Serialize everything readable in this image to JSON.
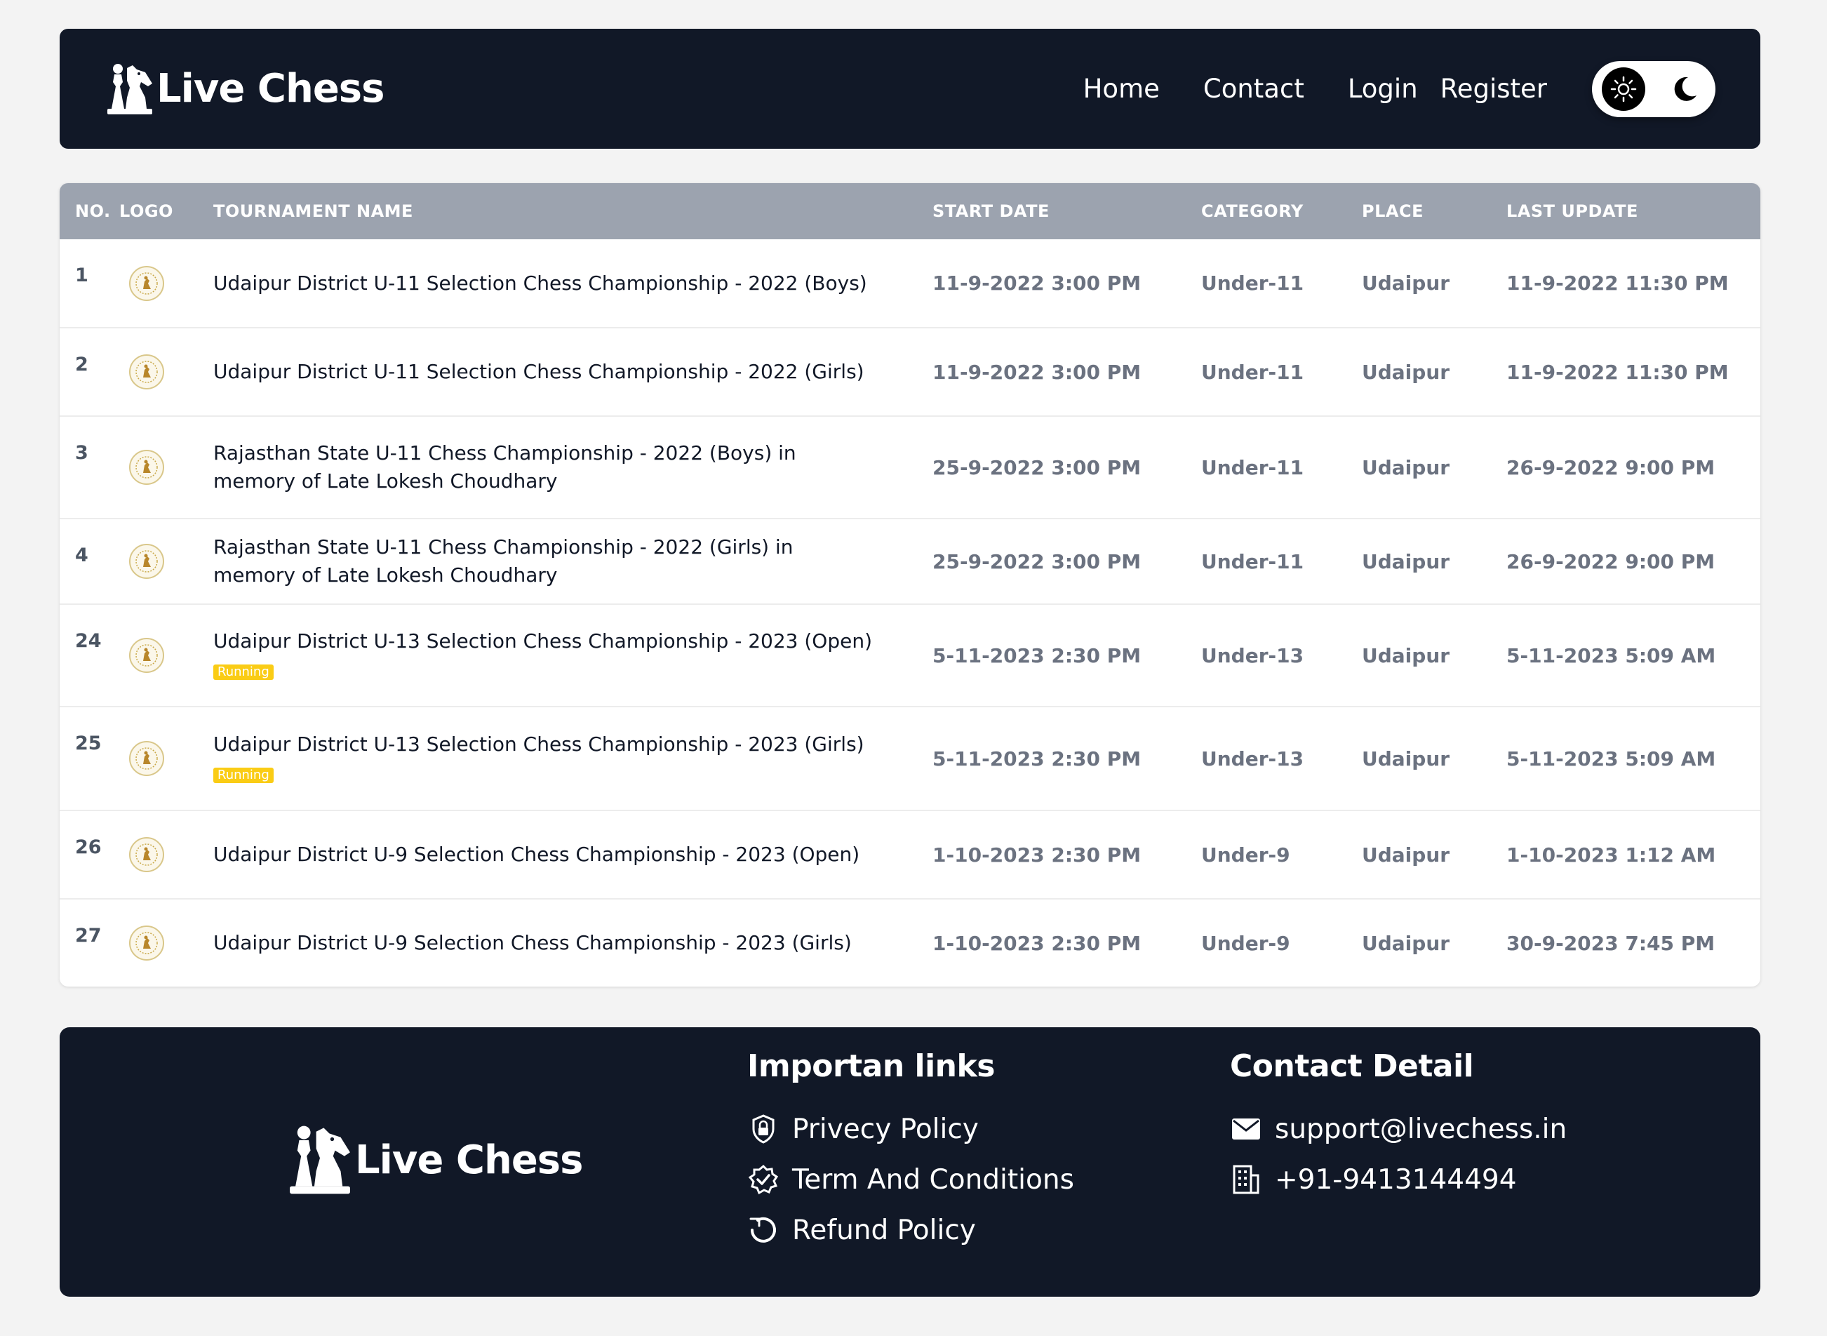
{
  "brand": {
    "name": "Live Chess"
  },
  "nav": {
    "home": "Home",
    "contact": "Contact",
    "login": "Login",
    "register": "Register"
  },
  "table": {
    "columns": {
      "no": "NO.",
      "logo": "LOGO",
      "name": "TOURNAMENT NAME",
      "start": "START DATE",
      "category": "CATEGORY",
      "place": "PLACE",
      "updated": "LAST UPDATE"
    },
    "rows": [
      {
        "no": "1",
        "name": "Udaipur District U-11 Selection Chess Championship - 2022 (Boys)",
        "badge": "",
        "start": "11-9-2022 3:00 PM",
        "category": "Under-11",
        "place": "Udaipur",
        "updated": "11-9-2022 11:30 PM"
      },
      {
        "no": "2",
        "name": "Udaipur District U-11 Selection Chess Championship - 2022 (Girls)",
        "badge": "",
        "start": "11-9-2022 3:00 PM",
        "category": "Under-11",
        "place": "Udaipur",
        "updated": "11-9-2022 11:30 PM"
      },
      {
        "no": "3",
        "name": "Rajasthan State U-11 Chess Championship - 2022 (Boys) in memory of Late Lokesh Choudhary",
        "badge": "",
        "start": "25-9-2022 3:00 PM",
        "category": "Under-11",
        "place": "Udaipur",
        "updated": "26-9-2022 9:00 PM"
      },
      {
        "no": "4",
        "name": "Rajasthan State U-11 Chess Championship - 2022 (Girls) in memory of Late Lokesh Choudhary",
        "badge": "",
        "start": "25-9-2022 3:00 PM",
        "category": "Under-11",
        "place": "Udaipur",
        "updated": "26-9-2022 9:00 PM"
      },
      {
        "no": "24",
        "name": "Udaipur District U-13 Selection Chess Championship - 2023 (Open)",
        "badge": "Running",
        "start": "5-11-2023 2:30 PM",
        "category": "Under-13",
        "place": "Udaipur",
        "updated": "5-11-2023 5:09 AM"
      },
      {
        "no": "25",
        "name": "Udaipur District U-13 Selection Chess Championship - 2023 (Girls)",
        "badge": "Running",
        "start": "5-11-2023 2:30 PM",
        "category": "Under-13",
        "place": "Udaipur",
        "updated": "5-11-2023 5:09 AM"
      },
      {
        "no": "26",
        "name": "Udaipur District U-9 Selection Chess Championship - 2023 (Open)",
        "badge": "",
        "start": "1-10-2023 2:30 PM",
        "category": "Under-9",
        "place": "Udaipur",
        "updated": "1-10-2023 1:12 AM"
      },
      {
        "no": "27",
        "name": "Udaipur District U-9 Selection Chess Championship - 2023 (Girls)",
        "badge": "",
        "start": "1-10-2023 2:30 PM",
        "category": "Under-9",
        "place": "Udaipur",
        "updated": "30-9-2023 7:45 PM"
      }
    ]
  },
  "footer": {
    "brand": "Live Chess",
    "links_heading": "Importan links",
    "links": [
      "Privecy Policy",
      "Term And Conditions",
      "Refund Policy"
    ],
    "contact_heading": "Contact Detail",
    "email": "support@livechess.in",
    "phone": "+91-9413144494"
  },
  "icons": {
    "brand": "chess-pieces-icon",
    "light_mode": "sun-icon",
    "dark_mode": "moon-icon",
    "row_logo": "association-logo-icon",
    "privacy": "shield-lock-icon",
    "terms": "badge-check-icon",
    "refund": "refund-icon",
    "email": "envelope-icon",
    "phone": "building-icon"
  },
  "colors": {
    "navbar_bg": "#111827",
    "table_header_bg": "#9ca3af",
    "badge_running": "#facc15",
    "page_bg": "#f3f3f3"
  }
}
